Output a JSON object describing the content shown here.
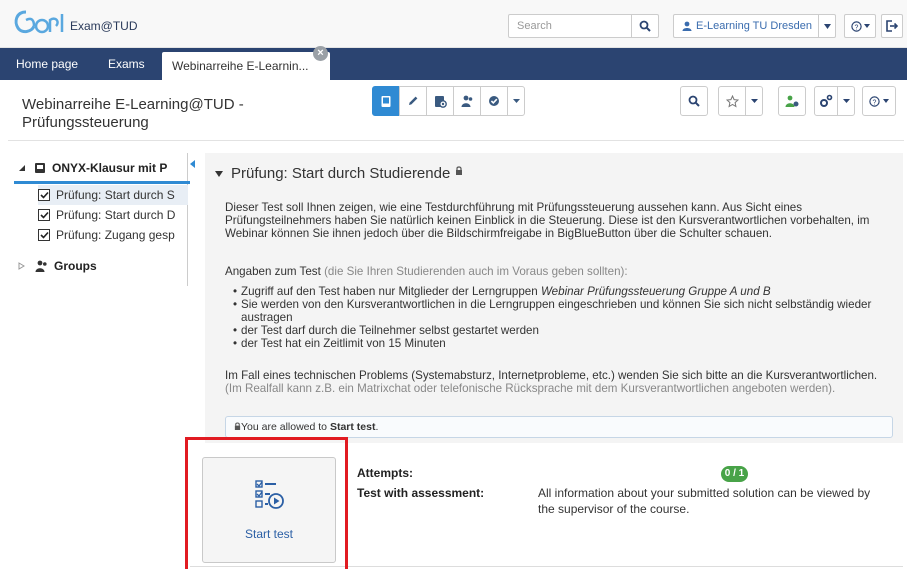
{
  "header": {
    "logo_text": "Exam@TUD",
    "search_placeholder": "Search",
    "user_label": "E-Learning TU Dresden"
  },
  "nav": {
    "home": "Home page",
    "exams": "Exams",
    "active_tab": "Webinarreihe E-Learnin...",
    "close_symbol": "×"
  },
  "course": {
    "title": "Webinarreihe E-Learning@TUD - Prüfungssteuerung"
  },
  "sidebar": {
    "root": "ONYX-Klausur mit P",
    "items": [
      {
        "label": "Prüfung: Start durch S"
      },
      {
        "label": "Prüfung: Start durch D"
      },
      {
        "label": "Prüfung: Zugang gesp"
      }
    ],
    "groups": "Groups"
  },
  "content": {
    "title": "Prüfung: Start durch Studierende",
    "intro": "Dieser Test soll Ihnen zeigen, wie eine Testdurchführung mit Prüfungssteuerung aussehen kann. Aus Sicht eines Prüfungsteilnehmers haben Sie natürlich keinen Einblick in die Steuerung. Diese ist den Kursverantwortlichen vorbehalten, im Webinar können Sie ihnen jedoch über die Bildschirmfreigabe in BigBlueButton über die Schulter schauen.",
    "details_label": "Angaben zum Test",
    "details_note": "(die Sie Ihren Studierenden auch im Voraus geben sollten):",
    "bullet1_prefix": "Zugriff auf den Test haben nur Mitglieder der Lerngruppen",
    "bullet1_em": "Webinar Prüfungssteuerung Gruppe A und B",
    "bullet2": "Sie werden von den Kursverantwortlichen in die Lerngruppen eingeschrieben und können Sie sich nicht selbständig wieder austragen",
    "bullet3": "der Test darf durch die Teilnehmer selbst gestartet werden",
    "bullet4": "der Test hat ein Zeitlimit von 15 Minuten",
    "problem_text": "Im Fall eines technischen Problems (Systemabsturz, Internetprobleme, etc.) wenden Sie sich bitte an die Kursverantwortlichen.",
    "problem_note": "(Im Realfall kann z.B. ein Matrixchat oder telefonische Rücksprache mit dem Kursverantwortlichen angeboten werden).",
    "allowed_prefix": "You are allowed to",
    "allowed_bold": "Start test",
    "allowed_suffix": "."
  },
  "test": {
    "start_label": "Start test",
    "attempts_label": "Attempts:",
    "attempts_value": "0 / 1",
    "assessment_label": "Test with assessment:",
    "assessment_value": "All information about your submitted solution can be viewed by the supervisor of the course."
  },
  "colors": {
    "navbar": "#2b4471",
    "accent": "#2f8ad3",
    "highlight": "#e11b22",
    "badge": "#48a348"
  }
}
